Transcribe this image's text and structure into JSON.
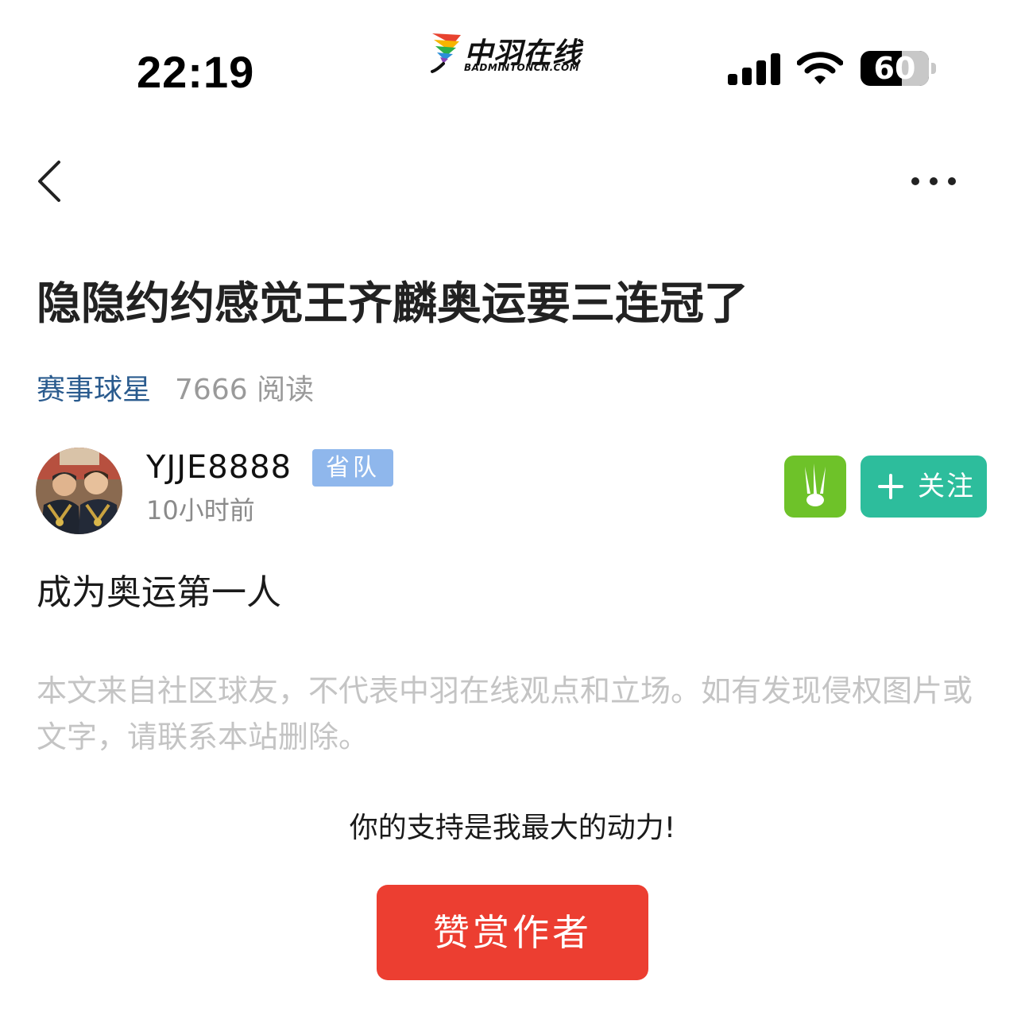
{
  "status_bar": {
    "time": "22:19",
    "battery_level": "60",
    "battery_fraction": 0.6,
    "icons": [
      "signal-icon",
      "wifi-icon",
      "battery-icon"
    ]
  },
  "brand": {
    "name_cn": "中羽在线",
    "name_en": "BADMINTONCN.COM",
    "colors": [
      "#e8432f",
      "#f7b500",
      "#2bb04a",
      "#2a8fd8",
      "#8a49b8"
    ]
  },
  "nav": {
    "back_icon": "chevron-left-icon",
    "more_icon": "more-horizontal-icon"
  },
  "post": {
    "title": "隐隐约约感觉王齐麟奥运要三连冠了",
    "category": "赛事球星",
    "reads": "7666 阅读",
    "body": "成为奥运第一人",
    "disclaimer": "本文来自社区球友，不代表中羽在线观点和立场。如有发现侵权图片或文字，请联系本站删除。"
  },
  "author": {
    "name": "YJJE8888",
    "badge": "省队",
    "time": "10小时前",
    "follow_label": "关注",
    "follow_icon": "plus-icon",
    "app_icon": "shuttlecock-icon"
  },
  "support": {
    "text": "你的支持是我最大的动力!",
    "reward_label": "赞赏作者"
  },
  "colors": {
    "category": "#2a5b8e",
    "badge": "#8fb7ec",
    "follow": "#2dbd9c",
    "app_icon": "#6ec229",
    "reward": "#ec3e31",
    "disclaimer": "#c4c4c4"
  }
}
